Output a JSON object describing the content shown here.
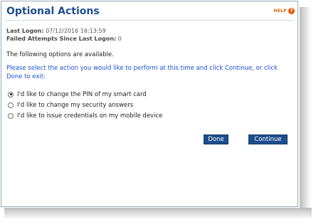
{
  "dialog": {
    "title": "Optional Actions",
    "help_label": "HELP",
    "help_icon_glyph": "?",
    "last_logon": {
      "label": "Last Logon:",
      "value": "07/12/2016 16:13:59"
    },
    "failed_attempts": {
      "label": "Failed Attempts Since Last Logon:",
      "value": "0"
    },
    "intro": "The following options are available.",
    "instruction": "Please select the action you would like to perform at this time and click Continue, or click Done to exit:",
    "options": [
      {
        "label": "I'd like to change the PIN of my smart card",
        "checked": true
      },
      {
        "label": "I'd like to change my security answers",
        "checked": false
      },
      {
        "label": "I'd like to issue credentials on my mobile device",
        "checked": false
      }
    ],
    "buttons": {
      "done": "Done",
      "continue": "Continue"
    }
  },
  "colors": {
    "title": "#1f4f92",
    "instruction_text": "#1a4fd8",
    "help_accent": "#e05a00",
    "button_bg": "#1e4e8c"
  }
}
